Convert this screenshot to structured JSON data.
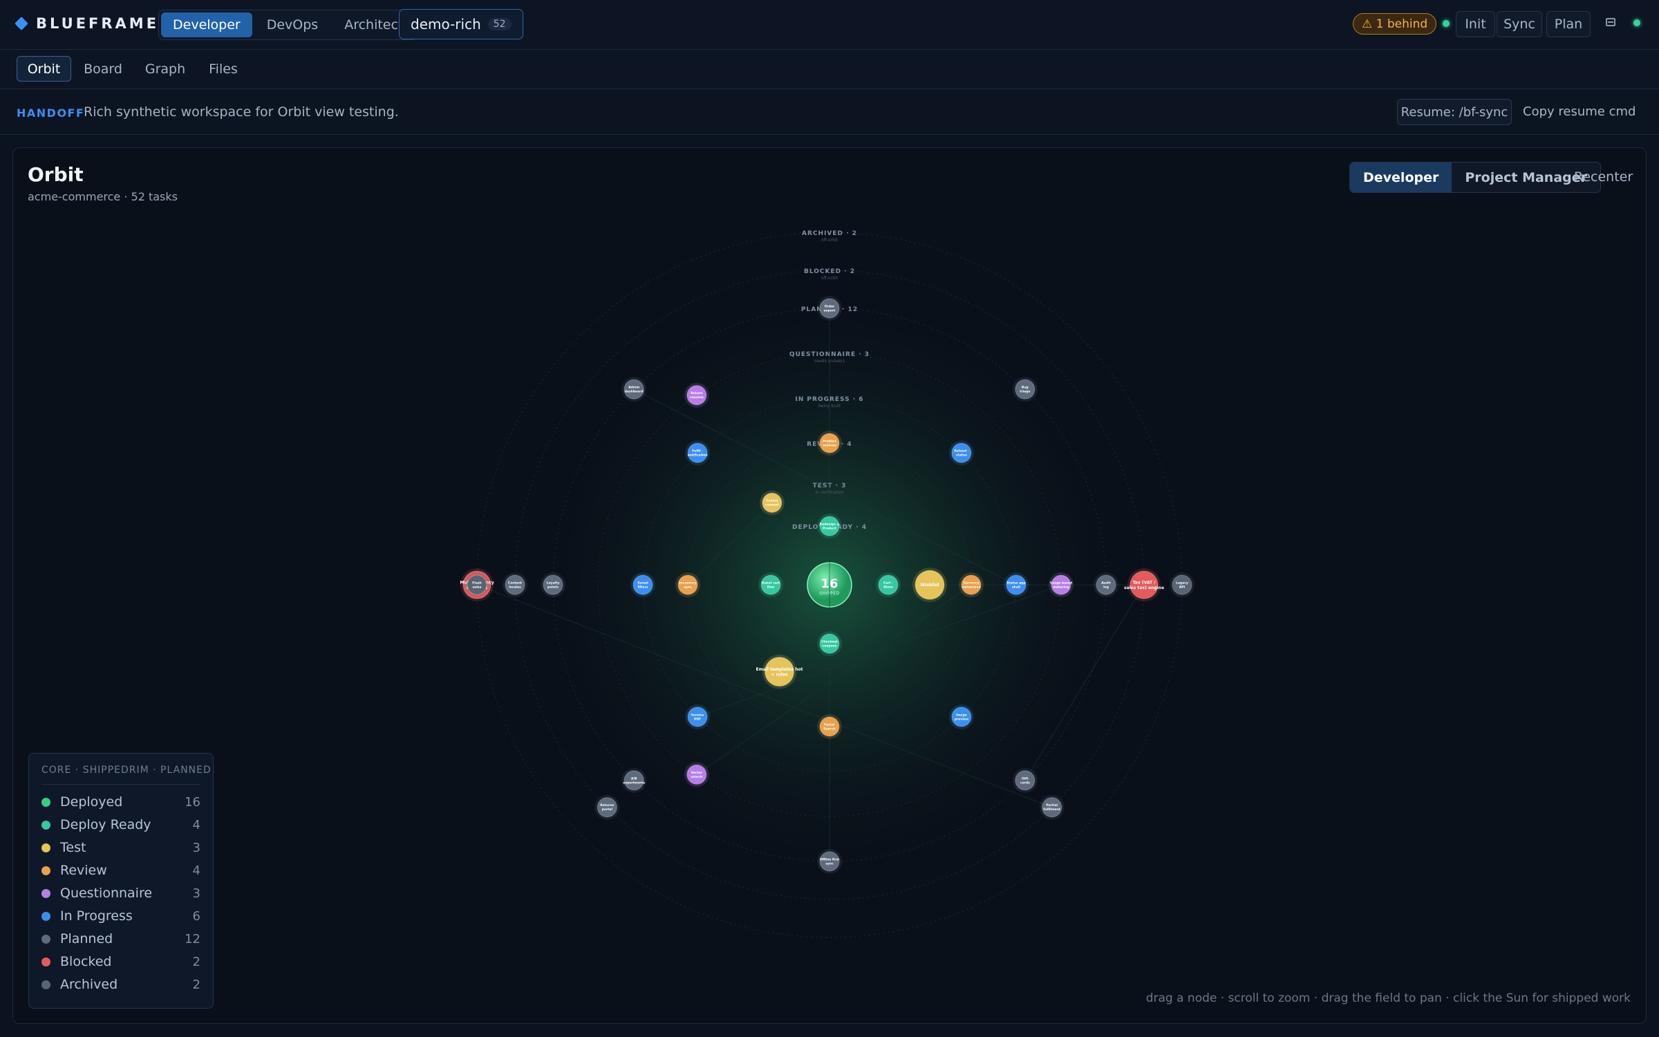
{
  "brand": {
    "name": "BLUEFRAME"
  },
  "modes": [
    {
      "label": "Developer",
      "active": true
    },
    {
      "label": "DevOps",
      "active": false
    },
    {
      "label": "Architect",
      "active": false
    }
  ],
  "workspace": {
    "name": "demo-rich",
    "count": "52"
  },
  "status": {
    "behind": "⚠ 1 behind"
  },
  "actions": {
    "init": "Init",
    "sync": "Sync",
    "plan": "Plan"
  },
  "tabs": [
    {
      "label": "Orbit",
      "active": true
    },
    {
      "label": "Board",
      "active": false
    },
    {
      "label": "Graph",
      "active": false
    },
    {
      "label": "Files",
      "active": false
    }
  ],
  "handoff": {
    "label": "HANDOFF",
    "text": "Rich synthetic workspace for Orbit view testing.",
    "resume": "Resume: /bf-sync",
    "copy": "Copy resume cmd"
  },
  "orbit": {
    "title": "Orbit",
    "subtitle": "acme-commerce · 52 tasks",
    "views": [
      {
        "label": "Developer",
        "active": true
      },
      {
        "label": "Project Manager",
        "active": false
      }
    ],
    "recenter": "Recenter",
    "sun": {
      "count": "16",
      "label": "SHIPPED"
    },
    "rings": [
      {
        "label": "ARCHIVED · 2",
        "sub": "off-orbit"
      },
      {
        "label": "BLOCKED · 2",
        "sub": "off-orbit"
      },
      {
        "label": "PLANNED · 12",
        "sub": ""
      },
      {
        "label": "QUESTIONNAIRE · 3",
        "sub": "needs answers"
      },
      {
        "label": "IN PROGRESS · 6",
        "sub": "being built"
      },
      {
        "label": "REVIEW · 4",
        "sub": ""
      },
      {
        "label": "TEST · 3",
        "sub": "in verification"
      },
      {
        "label": "DEPLOY READY · 4",
        "sub": ""
      }
    ],
    "hint": "drag a node · scroll to zoom · drag the field to pan · click the Sun for shipped work"
  },
  "legend": {
    "title": "CORE · SHIPPEDRIM · PLANNED",
    "items": [
      {
        "label": "Deployed",
        "count": "16",
        "color": "#35d07f"
      },
      {
        "label": "Deploy Ready",
        "count": "4",
        "color": "#34c9a0"
      },
      {
        "label": "Test",
        "count": "3",
        "color": "#e6c45a"
      },
      {
        "label": "Review",
        "count": "4",
        "color": "#eba04a"
      },
      {
        "label": "Questionnaire",
        "count": "3",
        "color": "#b77ee8"
      },
      {
        "label": "In Progress",
        "count": "6",
        "color": "#3b8ff0"
      },
      {
        "label": "Planned",
        "count": "12",
        "color": "#5f6b7d"
      },
      {
        "label": "Blocked",
        "count": "2",
        "color": "#e55a5a"
      },
      {
        "label": "Archived",
        "count": "2",
        "color": "#586474"
      }
    ]
  },
  "colors": {
    "accent": "#3b8ff0",
    "deployed": "#35d07f",
    "deploy_ready": "#34c9a0",
    "test": "#e6c45a",
    "review": "#eba04a",
    "questionnaire": "#b77ee8",
    "in_progress": "#3b8ff0",
    "planned": "#5f6b7d",
    "blocked": "#e55a5a",
    "archived": "#586474"
  },
  "nodes": [
    {
      "status": "deploy_ready",
      "text": "Redesign ≡ Product",
      "ring": 7,
      "angle": 270
    },
    {
      "status": "deploy_ready",
      "text": "Cart · Store",
      "ring": 7,
      "angle": 0
    },
    {
      "status": "deploy_ready",
      "text": "Checkout coupons",
      "ring": 7,
      "angle": 90
    },
    {
      "status": "deploy_ready",
      "text": "Guest cart flow",
      "ring": 7,
      "angle": 180
    },
    {
      "status": "test",
      "text": "Cookie consent",
      "ring": 6,
      "angle": 235
    },
    {
      "status": "test",
      "text": "Wishlist",
      "ring": 6,
      "angle": 0,
      "big": true
    },
    {
      "status": "test",
      "text": "Email templates hot + rules",
      "ring": 6,
      "angle": 120,
      "big": true
    },
    {
      "status": "review",
      "text": "Product reviews",
      "ring": 5,
      "angle": 270
    },
    {
      "status": "review",
      "text": "Currency conversion",
      "ring": 5,
      "angle": 0
    },
    {
      "status": "review",
      "text": "Inventory sync",
      "ring": 5,
      "angle": 180
    },
    {
      "status": "review",
      "text": "Faster Search",
      "ring": 5,
      "angle": 90
    },
    {
      "status": "questionnaire",
      "text": "Return reasons",
      "ring": 3,
      "angle": 235
    },
    {
      "status": "questionnaire",
      "text": "Usage based metering",
      "ring": 3,
      "angle": 0
    },
    {
      "status": "questionnaire",
      "text": "Vector search",
      "ring": 3,
      "angle": 125
    },
    {
      "status": "in_progress",
      "text": "Fulfil · notification",
      "ring": 4,
      "angle": 225
    },
    {
      "status": "in_progress",
      "text": "Refund · status",
      "ring": 4,
      "angle": 315
    },
    {
      "status": "in_progress",
      "text": "Status app shell",
      "ring": 4,
      "angle": 0
    },
    {
      "status": "in_progress",
      "text": "Invoice PDF",
      "ring": 4,
      "angle": 135
    },
    {
      "status": "in_progress",
      "text": "Image preview",
      "ring": 4,
      "angle": 45
    },
    {
      "status": "in_progress",
      "text": "Saved filters",
      "ring": 4,
      "angle": 180
    },
    {
      "status": "planned",
      "text": "Order export",
      "ring": 2,
      "angle": 270
    },
    {
      "status": "planned",
      "text": "Admin dashboard",
      "ring": 2,
      "angle": 225
    },
    {
      "status": "planned",
      "text": "Bug triage",
      "ring": 2,
      "angle": 315
    },
    {
      "status": "planned",
      "text": "Audit log",
      "ring": 2,
      "angle": 0
    },
    {
      "status": "planned",
      "text": "Gift cards",
      "ring": 2,
      "angle": 45
    },
    {
      "status": "planned",
      "text": "Offline first sync",
      "ring": 2,
      "angle": 90
    },
    {
      "status": "planned",
      "text": "A/B experiments",
      "ring": 2,
      "angle": 135
    },
    {
      "status": "planned",
      "text": "Loyalty points",
      "ring": 2,
      "angle": 180
    },
    {
      "status": "planned",
      "text": "Partial fulfilment",
      "ring": 1,
      "angle": 45
    },
    {
      "status": "planned",
      "text": "Two-factor auth TOTP",
      "ring": 1,
      "angle": 0
    },
    {
      "status": "planned",
      "text": "Returns portal",
      "ring": 1,
      "angle": 135
    },
    {
      "status": "planned",
      "text": "Content locales",
      "ring": 1,
      "angle": 180
    },
    {
      "status": "blocked",
      "text": "Tax (VAT / sales tax) engine",
      "ring": 1,
      "angle": 0
    },
    {
      "status": "blocked",
      "text": "Multi-currency checkout",
      "ring": 0,
      "angle": 180
    },
    {
      "status": "archived",
      "text": "Legacy API",
      "ring": 0,
      "angle": 0
    },
    {
      "status": "archived",
      "text": "Flash sales",
      "ring": 0,
      "angle": 180
    }
  ]
}
